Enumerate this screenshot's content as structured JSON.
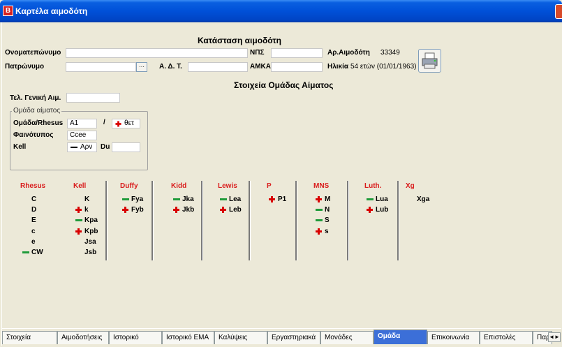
{
  "window": {
    "title": "Καρτέλα αιμοδότη",
    "app_icon_letter": "B"
  },
  "status_section": {
    "header": "Κατάσταση αιμοδότη",
    "fullname_label": "Ονοματεπώνυμο",
    "fullname_value": "",
    "patronym_label": "Πατρώνυμο",
    "patronym_value": "",
    "browse_button": "···",
    "adt_label": "Α. Δ. Τ.",
    "adt_value": "",
    "nps_label": "ΝΠΣ",
    "nps_value": "",
    "amka_label": "ΑΜΚΑ",
    "amka_value": "",
    "donor_no_label": "Αρ.Αιμοδότη",
    "donor_no_value": "33349",
    "age_label": "Ηλικία",
    "age_value": "54 ετών (01/01/1963)"
  },
  "blood_group_section": {
    "header": "Στοιχεία Ομάδας Αίματος",
    "last_general_label": "Τελ. Γενική Αιμ.",
    "last_general_value": "",
    "group_box_title": "Ομάδα αίματος",
    "abo_label": "Ομάδα/Rhesus",
    "abo_value": "A1",
    "slash": "/",
    "rhesus_value": "θετ",
    "phenotype_label": "Φαινότυπος",
    "phenotype_value": "Ccee",
    "kell_label": "Kell",
    "kell_value": "Αρν",
    "du_label": "Du",
    "du_value": ""
  },
  "antigen_columns": [
    {
      "title": "Rhesus",
      "items": [
        {
          "name": "C",
          "mark": ""
        },
        {
          "name": "D",
          "mark": ""
        },
        {
          "name": "E",
          "mark": ""
        },
        {
          "name": "c",
          "mark": ""
        },
        {
          "name": "e",
          "mark": ""
        },
        {
          "name": "CW",
          "mark": "minus"
        }
      ]
    },
    {
      "title": "Kell",
      "items": [
        {
          "name": "K",
          "mark": ""
        },
        {
          "name": "k",
          "mark": "plus"
        },
        {
          "name": "Kpa",
          "mark": "minus"
        },
        {
          "name": "Kpb",
          "mark": "plus"
        },
        {
          "name": "Jsa",
          "mark": ""
        },
        {
          "name": "Jsb",
          "mark": ""
        }
      ]
    },
    {
      "title": "Duffy",
      "items": [
        {
          "name": "Fya",
          "mark": "minus"
        },
        {
          "name": "Fyb",
          "mark": "plus"
        }
      ]
    },
    {
      "title": "Kidd",
      "items": [
        {
          "name": "Jka",
          "mark": "minus"
        },
        {
          "name": "Jkb",
          "mark": "plus"
        }
      ]
    },
    {
      "title": "Lewis",
      "items": [
        {
          "name": "Lea",
          "mark": "minus"
        },
        {
          "name": "Leb",
          "mark": "plus"
        }
      ]
    },
    {
      "title": "P",
      "items": [
        {
          "name": "P1",
          "mark": "plus"
        }
      ]
    },
    {
      "title": "MNS",
      "items": [
        {
          "name": "M",
          "mark": "plus"
        },
        {
          "name": "N",
          "mark": "minus"
        },
        {
          "name": "S",
          "mark": "minus"
        },
        {
          "name": "s",
          "mark": "plus"
        }
      ]
    },
    {
      "title": "Luth.",
      "items": [
        {
          "name": "Lua",
          "mark": "minus"
        },
        {
          "name": "Lub",
          "mark": "plus"
        }
      ]
    },
    {
      "title": "Xg",
      "items": [
        {
          "name": "Xga",
          "mark": ""
        }
      ]
    }
  ],
  "tabs": [
    {
      "label": "Στοιχεία",
      "active": false
    },
    {
      "label": "Αιμοδοτήσεις",
      "active": false
    },
    {
      "label": "Ιστορικό",
      "active": false
    },
    {
      "label": "Ιστορικό ΕΜΑ",
      "active": false
    },
    {
      "label": "Καλύψεις",
      "active": false
    },
    {
      "label": "Εργαστηριακά",
      "active": false
    },
    {
      "label": "Μονάδες",
      "active": false
    },
    {
      "label": "Ομάδα",
      "active": true
    },
    {
      "label": "Επικοινωνία",
      "active": false
    },
    {
      "label": "Επιστολές",
      "active": false
    },
    {
      "label": "Παρ",
      "active": false
    }
  ],
  "tab_scroll_left": "◄",
  "tab_scroll_right": "►",
  "icons": {
    "print": "printer-icon"
  },
  "colors": {
    "accent": "#0050d8",
    "group_title": "#d91c1c",
    "positive": "#d80000",
    "negative": "#1f9b3a",
    "active_tab": "#3c6fd8"
  }
}
